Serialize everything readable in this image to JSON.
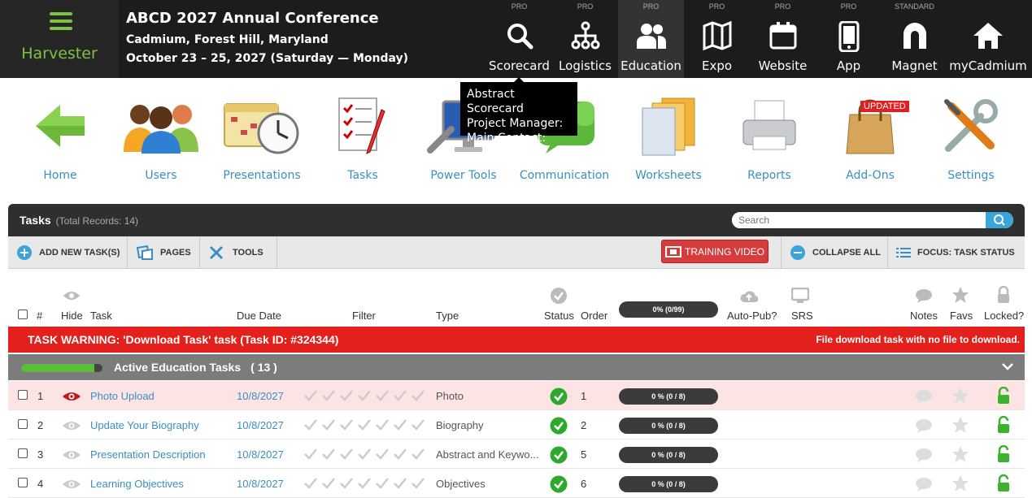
{
  "header": {
    "brand": "Harvester",
    "title": "ABCD 2027 Annual Conference",
    "location": "Cadmium, Forest Hill, Maryland",
    "dates": "October 23 – 25, 2027 (Saturday — Monday)"
  },
  "nav": [
    {
      "tier": "PRO",
      "label": "Scorecard",
      "icon": "search-icon"
    },
    {
      "tier": "PRO",
      "label": "Logistics",
      "icon": "org-chart-icon"
    },
    {
      "tier": "PRO",
      "label": "Education",
      "icon": "users-icon",
      "active": true
    },
    {
      "tier": "PRO",
      "label": "Expo",
      "icon": "map-icon"
    },
    {
      "tier": "PRO",
      "label": "Website",
      "icon": "calendar-icon"
    },
    {
      "tier": "PRO",
      "label": "App",
      "icon": "phone-icon"
    },
    {
      "tier": "STANDARD",
      "label": "Magnet",
      "icon": "magnet-icon"
    },
    {
      "tier": "",
      "label": "myCadmium",
      "icon": "home-icon"
    }
  ],
  "tooltip": {
    "line1": "Abstract Scorecard",
    "line2": "Project Manager:",
    "line3": "Main Contact:"
  },
  "apps": [
    {
      "label": "Home",
      "icon": "arrow-left-icon"
    },
    {
      "label": "Users",
      "icon": "people-icon"
    },
    {
      "label": "Presentations",
      "icon": "calendar-clock-icon"
    },
    {
      "label": "Tasks",
      "icon": "checklist-icon"
    },
    {
      "label": "Power Tools",
      "icon": "monitor-wrench-icon"
    },
    {
      "label": "Communication",
      "icon": "speech-bubble-icon"
    },
    {
      "label": "Worksheets",
      "icon": "folders-icon"
    },
    {
      "label": "Reports",
      "icon": "printer-icon"
    },
    {
      "label": "Add-Ons",
      "icon": "shopping-bag-icon",
      "badge": "UPDATED"
    },
    {
      "label": "Settings",
      "icon": "tools-icon"
    }
  ],
  "panel": {
    "title": "Tasks",
    "total": "(Total Records: 14)",
    "search_placeholder": "Search"
  },
  "toolbar": {
    "add": "ADD NEW TASK(S)",
    "pages": "PAGES",
    "tools": "TOOLS",
    "training": "TRAINING VIDEO",
    "collapse": "COLLAPSE ALL",
    "focus": "FOCUS: TASK STATUS"
  },
  "columns": {
    "num": "#",
    "hide": "Hide",
    "task": "Task",
    "due": "Due Date",
    "filter": "Filter",
    "type": "Type",
    "status": "Status",
    "order": "Order",
    "progress": "0% (0/99)",
    "autopub": "Auto-Pub?",
    "srs": "SRS",
    "notes": "Notes",
    "favs": "Favs",
    "locked": "Locked?"
  },
  "warning": {
    "left": "TASK WARNING: 'Download Task' task (Task ID: #324344)",
    "right": "File download task with no file to download."
  },
  "group": {
    "label": "Active Education Tasks",
    "count": "( 13 )",
    "progress": 0.9
  },
  "rows": [
    {
      "num": "1",
      "task": "Photo Upload",
      "due": "10/8/2027",
      "type": "Photo",
      "order": "1",
      "progress": "0 % (0 / 8)",
      "highlight": true
    },
    {
      "num": "2",
      "task": "Update Your Biography",
      "due": "10/8/2027",
      "type": "Biography",
      "order": "2",
      "progress": "0 % (0 / 8)"
    },
    {
      "num": "3",
      "task": "Presentation Description",
      "due": "10/8/2027",
      "type": "Abstract and Keywo...",
      "order": "5",
      "progress": "0 % (0 / 8)"
    },
    {
      "num": "4",
      "task": "Learning Objectives",
      "due": "10/8/2027",
      "type": "Objectives",
      "order": "6",
      "progress": "0 % (0 / 8)"
    }
  ],
  "colors": {
    "accent": "#7ec242",
    "link": "#3a8fc0",
    "warning": "#e3201c"
  }
}
